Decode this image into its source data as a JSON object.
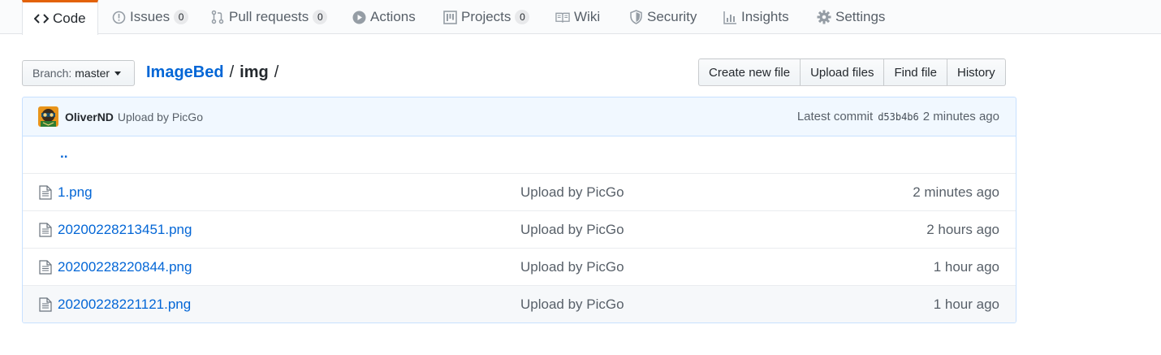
{
  "nav": {
    "tabs": [
      {
        "label": "Code",
        "icon": "code-icon",
        "selected": true
      },
      {
        "label": "Issues",
        "icon": "issue-icon",
        "count": "0"
      },
      {
        "label": "Pull requests",
        "icon": "pull-request-icon",
        "count": "0"
      },
      {
        "label": "Actions",
        "icon": "play-icon"
      },
      {
        "label": "Projects",
        "icon": "project-icon",
        "count": "0"
      },
      {
        "label": "Wiki",
        "icon": "book-icon"
      },
      {
        "label": "Security",
        "icon": "shield-icon"
      },
      {
        "label": "Insights",
        "icon": "graph-icon"
      },
      {
        "label": "Settings",
        "icon": "gear-icon"
      }
    ]
  },
  "toolbar": {
    "branch_label": "Branch:",
    "branch_value": "master",
    "breadcrumb": {
      "repo": "ImageBed",
      "sep1": "/",
      "dir": "img",
      "sep2": "/"
    },
    "buttons": {
      "create": "Create new file",
      "upload": "Upload files",
      "find": "Find file",
      "history": "History"
    }
  },
  "commit": {
    "author": "OliverND",
    "message": "Upload by PicGo",
    "latest_label": "Latest commit",
    "sha": "d53b4b6",
    "age": "2 minutes ago"
  },
  "files": {
    "up": "..",
    "rows": [
      {
        "name": "1.png",
        "message": "Upload by PicGo",
        "age": "2 minutes ago"
      },
      {
        "name": "20200228213451.png",
        "message": "Upload by PicGo",
        "age": "2 hours ago"
      },
      {
        "name": "20200228220844.png",
        "message": "Upload by PicGo",
        "age": "1 hour ago"
      },
      {
        "name": "20200228221121.png",
        "message": "Upload by PicGo",
        "age": "1 hour ago"
      }
    ]
  },
  "colors": {
    "link": "#0366d6",
    "accent_tab": "#e36209",
    "commit_bg": "#f1f8ff",
    "commit_border": "#c8e1ff"
  }
}
